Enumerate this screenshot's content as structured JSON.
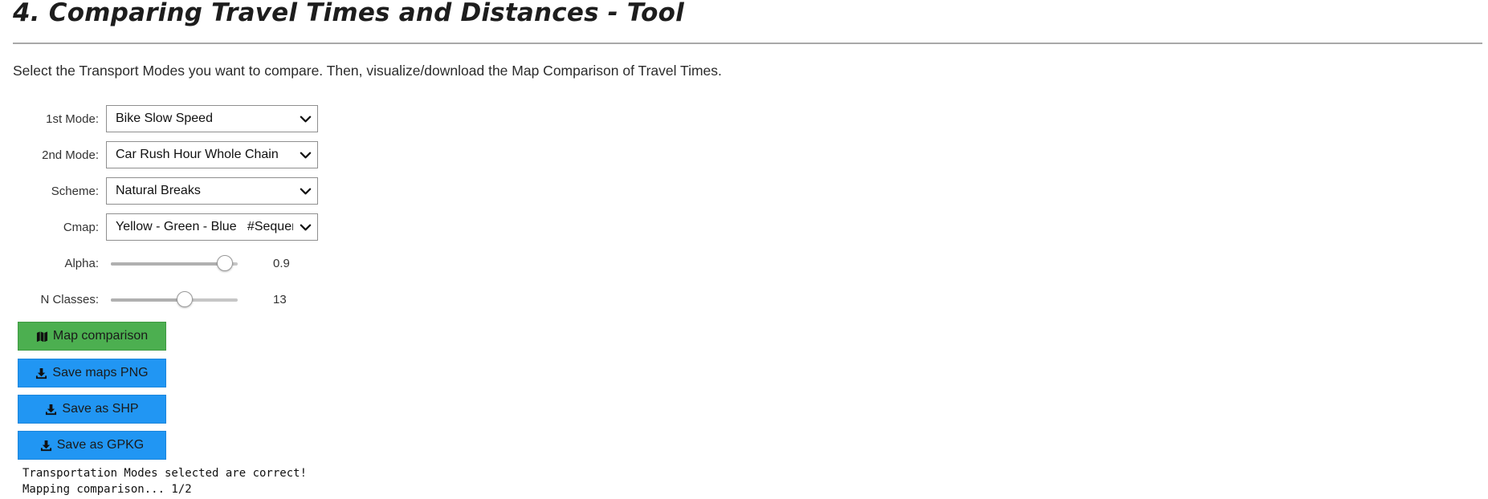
{
  "header": {
    "title": "4. Comparing Travel Times and Distances - Tool",
    "intro": "Select the Transport Modes you want to compare. Then, visualize/download the Map Comparison of Travel Times."
  },
  "form": {
    "mode1": {
      "label": "1st Mode:",
      "value": "Bike Slow Speed"
    },
    "mode2": {
      "label": "2nd Mode:",
      "value": "Car Rush Hour Whole Chain"
    },
    "scheme": {
      "label": "Scheme:",
      "value": "Natural Breaks"
    },
    "cmap": {
      "label": "Cmap:",
      "value": "Yellow - Green - Blue   #Sequential"
    },
    "alpha": {
      "label": "Alpha:",
      "value": "0.9",
      "fraction": 0.9
    },
    "nclasses": {
      "label": "N Classes:",
      "value": "13",
      "fraction": 0.58
    }
  },
  "buttons": {
    "map_comparison": {
      "label": "Map comparison",
      "icon": "map-icon",
      "color": "#4caf50"
    },
    "save_png": {
      "label": "Save maps PNG",
      "icon": "download-icon",
      "color": "#2196f3"
    },
    "save_shp": {
      "label": "Save as SHP",
      "icon": "download-icon",
      "color": "#2196f3"
    },
    "save_gpkg": {
      "label": "Save as GPKG",
      "icon": "download-icon",
      "color": "#2196f3"
    }
  },
  "output": {
    "lines": [
      "Transportation Modes selected are correct!",
      "Mapping comparison... 1/2"
    ]
  }
}
